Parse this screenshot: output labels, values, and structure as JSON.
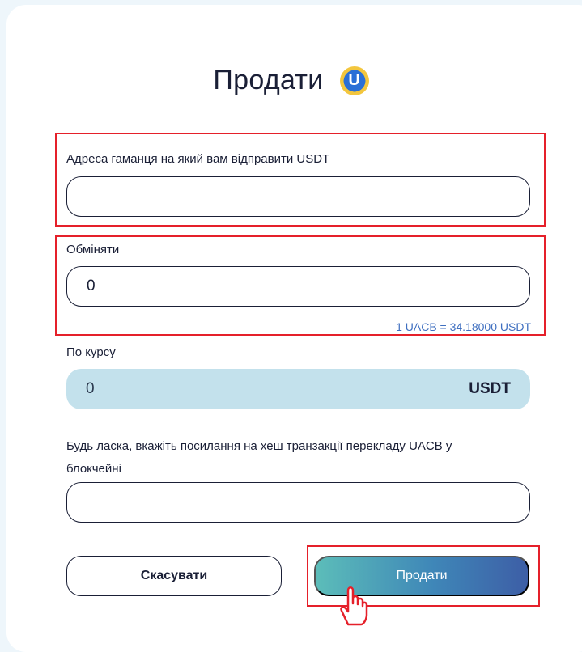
{
  "form": {
    "title": "Продати",
    "coin_letter": "U",
    "wallet_label": "Адреса гаманця на який вам відправити USDT",
    "wallet_value": "",
    "exchange_label": "Обміняти",
    "exchange_value": "0",
    "exchange_rate_hint": "1 UACB = 34.18000 USDT",
    "rate_label": "По курсу",
    "rate_value": "0",
    "rate_currency": "USDT",
    "hash_label": "Будь ласка, вкажіть посилання на хеш транзакції перекладу UACB у блокчейні",
    "hash_value": "",
    "cancel_label": "Скасувати",
    "sell_label": "Продати"
  },
  "colors": {
    "highlight": "#e5202a",
    "rate_bg": "#c3e1ec",
    "hint": "#3f6fc0"
  },
  "icons": {
    "title_icon": "uacb-coin-icon",
    "cursor": "hand-pointer-icon"
  }
}
